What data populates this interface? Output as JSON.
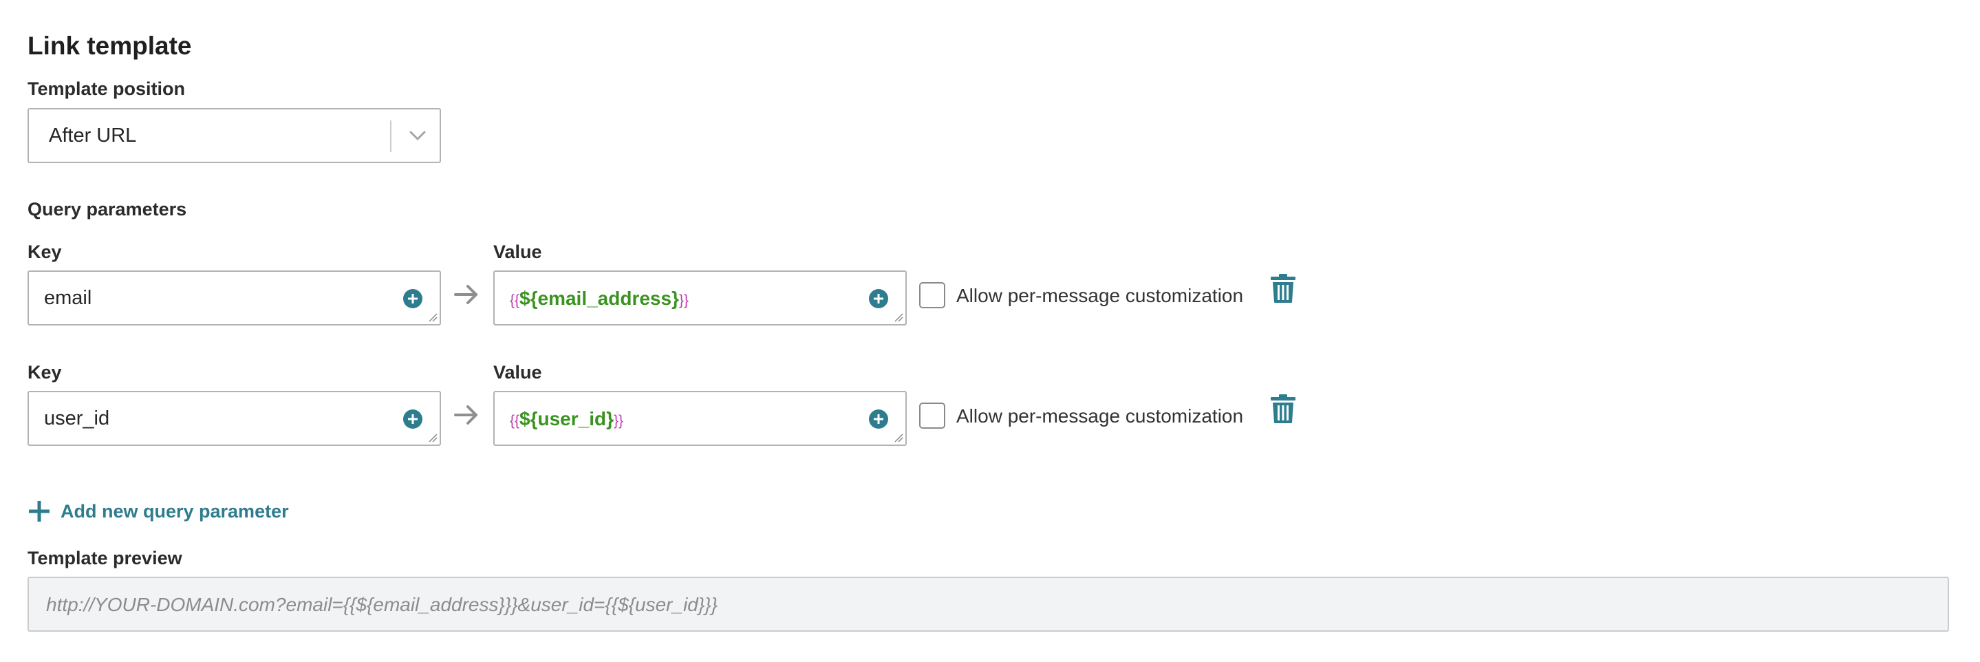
{
  "section": {
    "title": "Link template",
    "template_position_label": "Template position",
    "template_position_value": "After URL",
    "query_parameters_label": "Query parameters"
  },
  "params": [
    {
      "key_label": "Key",
      "key_value": "email",
      "value_label": "Value",
      "value_open": "{{",
      "value_var": "${email_address}",
      "value_close": "}}",
      "checkbox_label": "Allow per-message customization",
      "checked": false
    },
    {
      "key_label": "Key",
      "key_value": "user_id",
      "value_label": "Value",
      "value_open": "{{",
      "value_var": "${user_id}",
      "value_close": "}}",
      "checkbox_label": "Allow per-message customization",
      "checked": false
    }
  ],
  "add_param_label": "Add new query parameter",
  "preview": {
    "label": "Template preview",
    "placeholder": "http://YOUR-DOMAIN.com?email={{${email_address}}}&user_id={{${user_id}}}"
  },
  "icons": {
    "select_chevron": "chevron-down-icon",
    "field_action": "plus-circle-icon",
    "mapping_arrow": "arrow-right-icon",
    "remove": "trash-icon",
    "add": "plus-icon"
  },
  "colors": {
    "accent": "#2e7d8f",
    "variable": "#3a9321",
    "brace": "#c23bb0",
    "border": "#b3b3b3",
    "preview_bg": "#f1f3f4"
  }
}
